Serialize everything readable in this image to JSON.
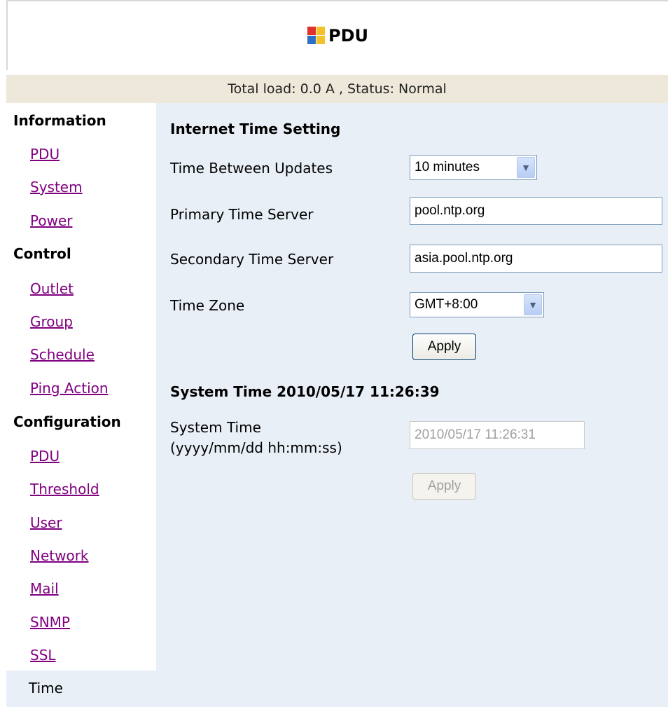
{
  "header": {
    "title": "PDU",
    "logo_icon": "pdu-logo-icon"
  },
  "status": {
    "text": "Total load: 0.0 A , Status: Normal"
  },
  "sidebar": {
    "sections": [
      {
        "heading": "Information",
        "items": [
          "PDU",
          "System",
          "Power"
        ]
      },
      {
        "heading": "Control",
        "items": [
          "Outlet",
          "Group",
          "Schedule",
          "Ping Action"
        ]
      },
      {
        "heading": "Configuration",
        "items": [
          "PDU",
          "Threshold",
          "User",
          "Network",
          "Mail",
          "SNMP",
          "SSL"
        ]
      }
    ],
    "current": "Time"
  },
  "internet_time": {
    "title": "Internet Time Setting",
    "update_label": "Time Between Updates",
    "update_value": "10 minutes",
    "primary_label": "Primary Time Server",
    "primary_value": "pool.ntp.org",
    "secondary_label": "Secondary Time Server",
    "secondary_value": "asia.pool.ntp.org",
    "zone_label": "Time Zone",
    "zone_value": "GMT+8:00",
    "apply_label": "Apply"
  },
  "system_time": {
    "title": "System Time 2010/05/17 11:26:39",
    "label_line1": "System Time",
    "label_line2": "(yyyy/mm/dd hh:mm:ss)",
    "value": "2010/05/17 11:26:31",
    "apply_label": "Apply"
  },
  "colors": {
    "status_bg": "#ede8da",
    "content_bg": "#e9eff7",
    "link_visited": "#800080"
  }
}
